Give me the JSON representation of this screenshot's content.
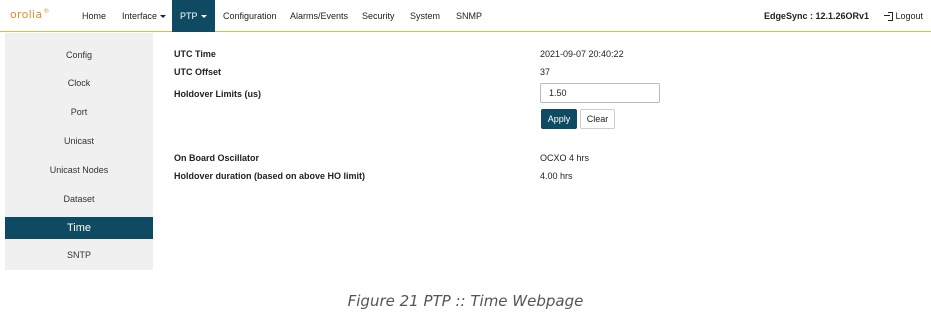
{
  "header": {
    "logo_text": "orolia",
    "logo_mark": "®",
    "nav": [
      {
        "label": "Home"
      },
      {
        "label": "Interface"
      },
      {
        "label": "PTP"
      },
      {
        "label": "Configuration"
      },
      {
        "label": "Alarms/Events"
      },
      {
        "label": "Security"
      },
      {
        "label": "System"
      },
      {
        "label": "SNMP"
      }
    ],
    "brand": "EdgeSync : 12.1.26ORv1",
    "logout_label": "Logout",
    "accent_color": "#0f4a63",
    "border_color": "#e6b84a"
  },
  "sidebar": {
    "items": [
      {
        "label": "Config"
      },
      {
        "label": "Clock"
      },
      {
        "label": "Port"
      },
      {
        "label": "Unicast"
      },
      {
        "label": "Unicast Nodes"
      },
      {
        "label": "Dataset"
      },
      {
        "label": "Time"
      },
      {
        "label": "SNTP"
      }
    ],
    "active": "Time"
  },
  "main": {
    "utc_time_label": "UTC Time",
    "utc_time_value": "2021-09-07 20:40:22",
    "utc_offset_label": "UTC Offset",
    "utc_offset_value": "37",
    "holdover_limits_label": "Holdover Limits (us)",
    "holdover_limits_value": "1.50",
    "apply_label": "Apply",
    "clear_label": "Clear",
    "oscillator_label": "On Board Oscillator",
    "oscillator_value": "OCXO 4 hrs",
    "holdover_duration_label": "Holdover duration (based on above HO limit)",
    "holdover_duration_value": "4.00 hrs"
  },
  "caption": "Figure 21 PTP :: Time Webpage"
}
